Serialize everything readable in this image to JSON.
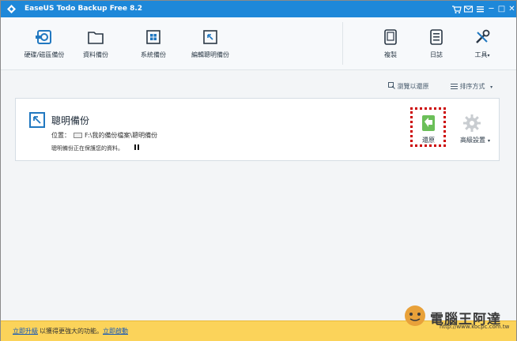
{
  "window": {
    "title": "EaseUS Todo Backup Free 8.2",
    "controls": {
      "cart": "cart-icon",
      "envelope": "envelope-icon",
      "menu": "menu-icon",
      "minimize": "─",
      "maximize": "□",
      "close": "✕"
    }
  },
  "toolbar": {
    "items": [
      {
        "label": "硬碟/磁區備份",
        "icon": "disk-partition-backup-icon"
      },
      {
        "label": "資料備份",
        "icon": "folder-icon"
      },
      {
        "label": "系統備份",
        "icon": "windows-system-icon"
      },
      {
        "label": "編輯聰明備份",
        "icon": "smart-backup-icon"
      }
    ],
    "right_items": [
      {
        "label": "複製",
        "icon": "clone-icon"
      },
      {
        "label": "日誌",
        "icon": "log-icon"
      },
      {
        "label": "工具",
        "icon": "tools-icon",
        "dropdown": "▾"
      }
    ]
  },
  "sort_bar": {
    "browse_label": "瀏覽以還原",
    "sort_label": "排序方式",
    "sort_caret": "▾"
  },
  "backup_task": {
    "name": "聰明備份",
    "location_label": "位置：",
    "location_path": "F:\\我的備份檔案\\聰明備份",
    "status": "聰明備份正在保護您的資料。",
    "restore_label": "還原",
    "advanced_label": "高級設置",
    "advanced_caret": "▾"
  },
  "bottom_bar": {
    "upgrade_link": "立即升級",
    "upgrade_text": "以獲得更強大的功能。",
    "activate_link": "立即啟動"
  },
  "watermark": {
    "title": "電腦王阿達",
    "url": "http://www.kocpc.com.tw"
  },
  "colors": {
    "titlebar": "#1e88d9",
    "accent": "#2178c0",
    "restore_green": "#6bbf59",
    "highlight_box": "#cc0000",
    "bottom_bar": "#fbd35a"
  }
}
